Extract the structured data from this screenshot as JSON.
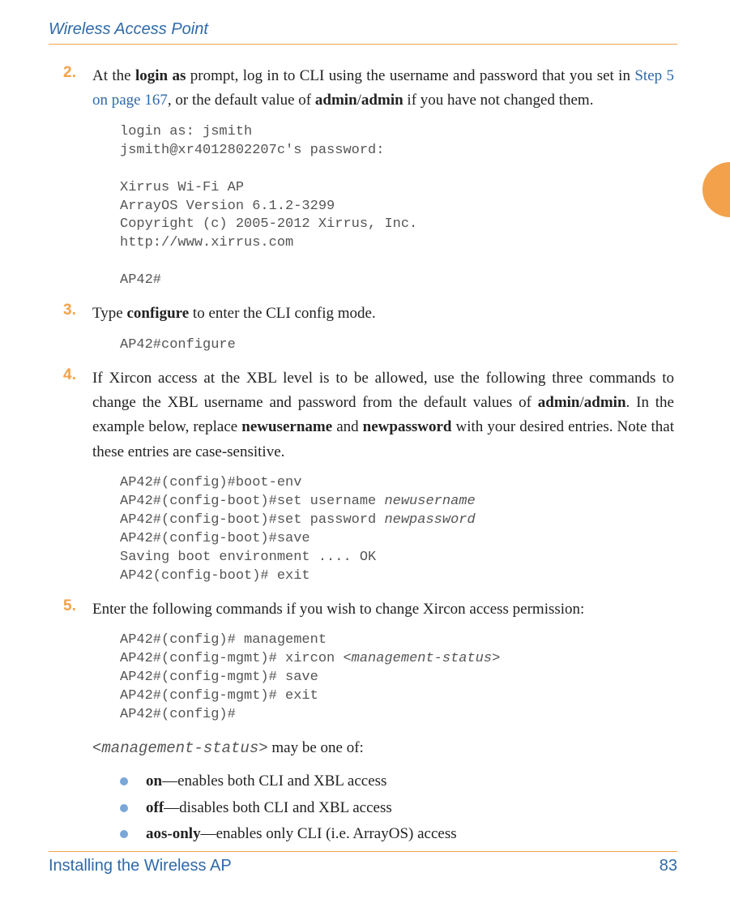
{
  "header": {
    "running_head": "Wireless Access Point"
  },
  "steps": {
    "s2": {
      "num": "2.",
      "text_a": "At the ",
      "bold_a": "login as",
      "text_b": " prompt, log in to CLI using the username and password that you set in ",
      "link": "Step 5 on page 167",
      "text_c": ", or the default value of ",
      "bold_b": "admin",
      "slash": "/",
      "bold_c": "admin",
      "text_d": " if you have not changed them.",
      "code": "login as: jsmith\njsmith@xr4012802207c's password:\n\nXirrus Wi-Fi AP\nArrayOS Version 6.1.2-3299\nCopyright (c) 2005-2012 Xirrus, Inc.\nhttp://www.xirrus.com\n\nAP42#"
    },
    "s3": {
      "num": "3.",
      "text_a": "Type ",
      "bold_a": "configure",
      "text_b": " to enter the CLI config mode.",
      "code": "AP42#configure"
    },
    "s4": {
      "num": "4.",
      "text_a": "If Xircon access at the XBL level is to be allowed, use the following three commands to change the XBL username and password from the default values of ",
      "bold_a": "admin",
      "slash": "/",
      "bold_b": "admin",
      "text_b": ". In the example below, replace ",
      "bold_c": "newusername",
      "text_c": " and ",
      "bold_d": "newpassword",
      "text_d": " with your desired entries. Note that these entries are case-sensitive.",
      "code_pre": "AP42#(config)#boot-env\nAP42#(config-boot)#set username ",
      "code_ital1": "newusername",
      "code_mid1": "\nAP42#(config-boot)#set password ",
      "code_ital2": "newpassword",
      "code_post": "\nAP42#(config-boot)#save\nSaving boot environment .... OK\nAP42(config-boot)# exit"
    },
    "s5": {
      "num": "5.",
      "text_a": "Enter the following commands if you wish to change Xircon access permission:",
      "code_pre": "AP42#(config)# management\nAP42#(config-mgmt)# xircon <",
      "code_ital": "management-status",
      "code_post": ">\nAP42#(config-mgmt)# save\nAP42#(config-mgmt)# exit\nAP42#(config)#",
      "tail_pre": "<",
      "tail_ital": "management-status",
      "tail_post": "> may be one of:",
      "bullets": {
        "b1": {
          "bold": "on",
          "text": "—enables both CLI and XBL access"
        },
        "b2": {
          "bold": "off",
          "text": "—disables both CLI and XBL access"
        },
        "b3": {
          "bold": "aos-only",
          "text": "—enables only CLI (i.e. ArrayOS) access"
        }
      }
    }
  },
  "footer": {
    "left": "Installing the Wireless AP",
    "right": "83"
  }
}
